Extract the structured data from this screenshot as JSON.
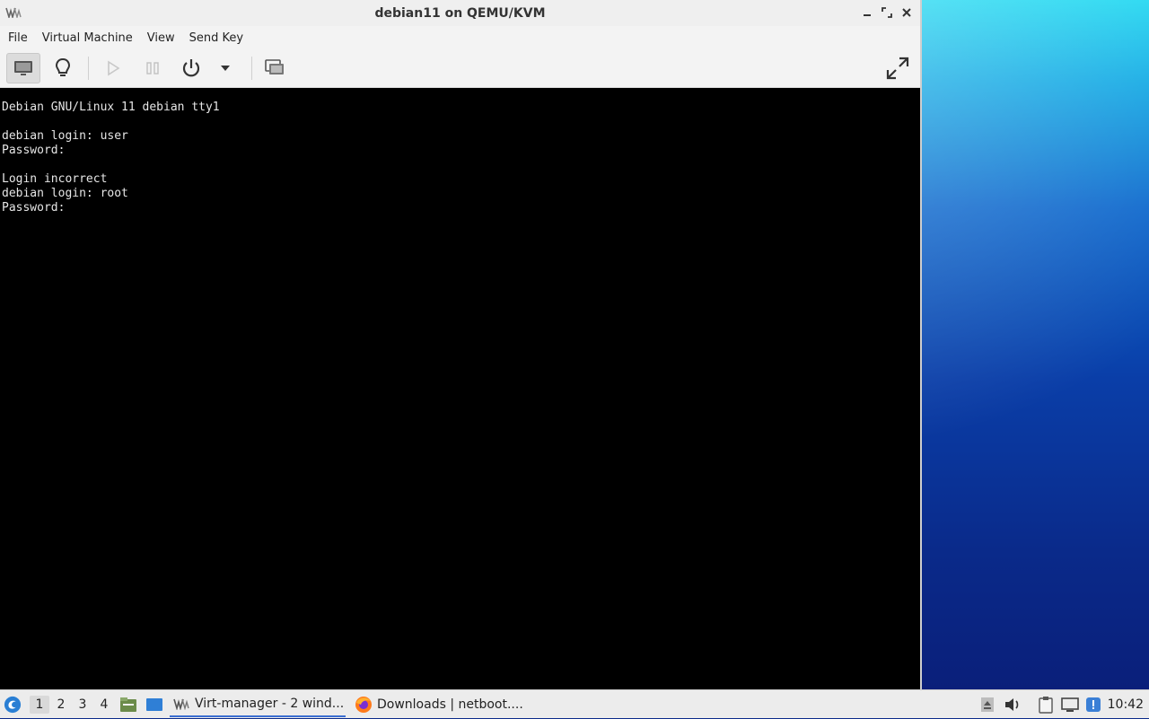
{
  "window": {
    "title": "debian11 on QEMU/KVM",
    "buttons": {
      "minimize": "–",
      "maximize": "⤢",
      "close": "✕"
    }
  },
  "menubar": {
    "items": [
      "File",
      "Virtual Machine",
      "View",
      "Send Key"
    ]
  },
  "toolbar": {
    "icons": [
      "monitor-icon",
      "lightbulb-icon",
      "play-icon",
      "pause-icon",
      "power-icon",
      "dropdown-arrow-icon",
      "screenshot-icon",
      "fullscreen-icon"
    ]
  },
  "console": {
    "lines": [
      "Debian GNU/Linux 11 debian tty1",
      "",
      "debian login: user",
      "Password:",
      "",
      "Login incorrect",
      "debian login: root",
      "Password:"
    ]
  },
  "taskbar": {
    "workspaces": [
      "1",
      "2",
      "3",
      "4"
    ],
    "active_workspace": "1",
    "tasks": [
      {
        "label": "Virt-manager - 2 wind...",
        "icon": "virt-manager-icon"
      },
      {
        "label": "Downloads | netboot....",
        "icon": "firefox-icon"
      }
    ],
    "tray_icons": [
      "eject-icon",
      "volume-icon",
      "clipboard-icon",
      "network-icon",
      "update-notifier-icon"
    ],
    "clock": "10:42"
  },
  "colors": {
    "accent": "#3b6fd1",
    "console_bg": "#000000",
    "console_fg": "#e6e6e6"
  }
}
